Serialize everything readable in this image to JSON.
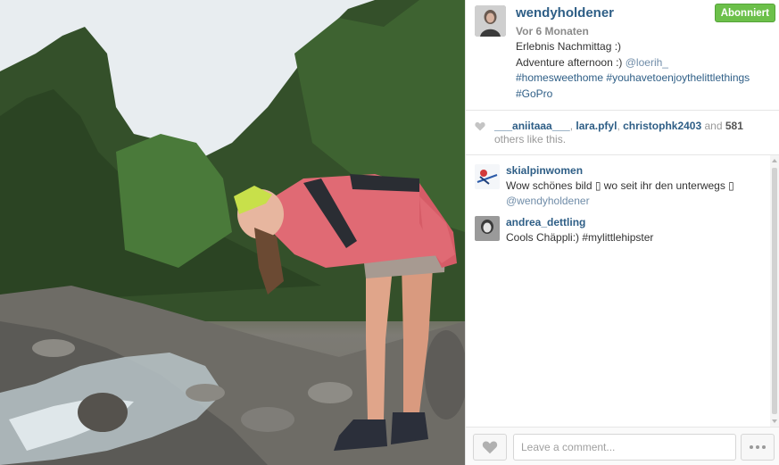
{
  "post": {
    "username": "wendyholdener",
    "time": "Vor 6 Monaten",
    "follow_label": "Abonniert",
    "caption": {
      "line1": "Erlebnis Nachmittag :)",
      "line2_text": "Adventure afternoon :) ",
      "line2_mention": "@loerih_",
      "line3": "#homesweethome #youhavetoenjoythelittlethings",
      "line4": "#GoPro"
    }
  },
  "likes": {
    "user1": "___aniitaaa___",
    "sep1": ", ",
    "user2": "lara.pfyl",
    "sep2": ", ",
    "user3": "christophk2403",
    "and": " and ",
    "count": "581",
    "rest": " others like this."
  },
  "comments": [
    {
      "username": "skialpinwomen",
      "text": "Wow schönes bild ▯ wo seit ihr den unterwegs ▯",
      "mention": "@wendyholdener"
    },
    {
      "username": "andrea_dettling",
      "text": "Cools Chäppli:) #mylittlehipster"
    }
  ],
  "footer": {
    "comment_placeholder": "Leave a comment..."
  },
  "icons": {
    "heart": "heart-icon",
    "more": "more-icon"
  },
  "colors": {
    "link": "#2e5e86",
    "follow": "#6cc04a"
  }
}
